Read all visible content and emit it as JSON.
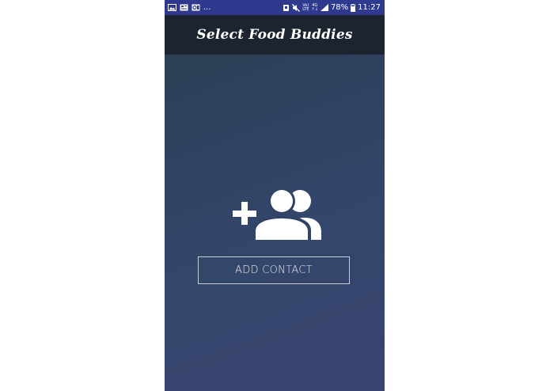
{
  "status_bar": {
    "notification_icons": [
      "gallery-icon",
      "news-icon",
      "outlook-icon"
    ],
    "overflow": "...",
    "system_icons": [
      "alarm-icon",
      "mute-icon",
      "volte-icon",
      "4g-icon",
      "signal-icon"
    ],
    "volte_label_top": "Vo)",
    "volte_label_bottom": "LTE",
    "net_label_top": "4G",
    "net_label_bottom": "↑↓",
    "battery": "78%",
    "time": "11:27"
  },
  "app_bar": {
    "title": "Select Food Buddies"
  },
  "main": {
    "icon": "add-group-icon",
    "add_contact_label": "ADD CONTACT"
  },
  "colors": {
    "status_bar": "#2f3a8f",
    "app_bar": "#1c2430",
    "content_top": "#2b3f55",
    "content_bottom": "#3a4470",
    "button_border": "#c8ccd6"
  }
}
